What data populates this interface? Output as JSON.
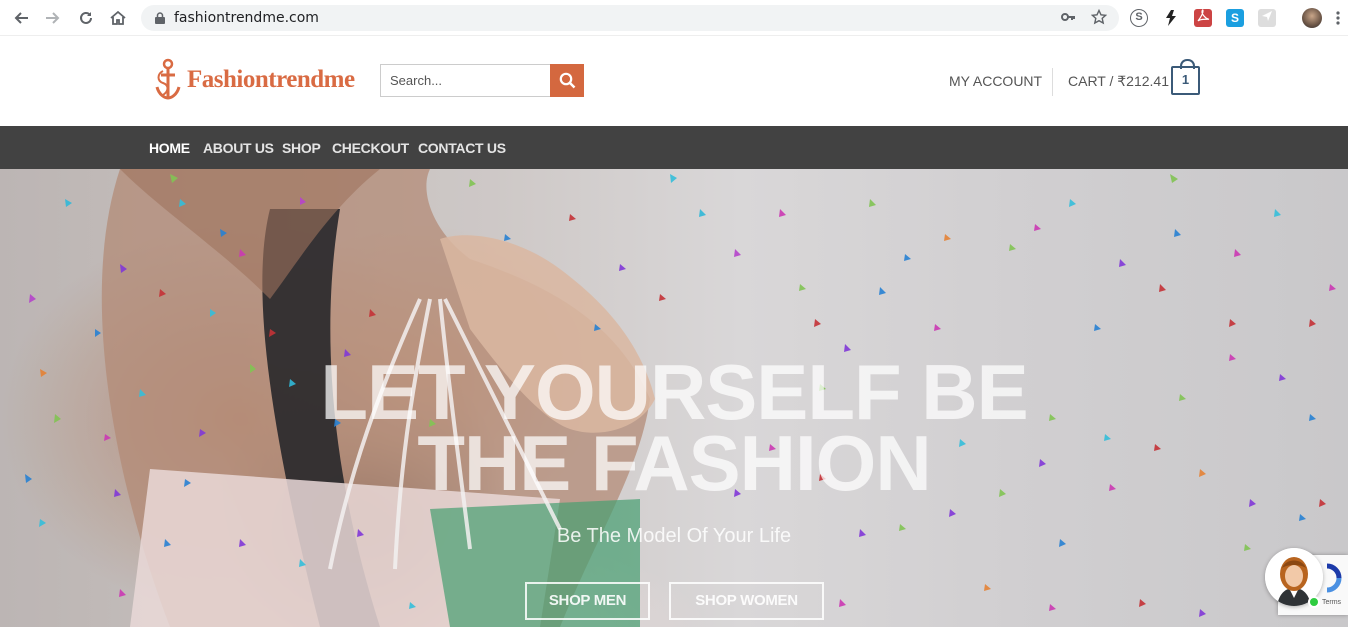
{
  "browser": {
    "url": "fashiontrendme.com"
  },
  "header": {
    "logo_text": "Fashiontrendme",
    "search_placeholder": "Search...",
    "my_account": "MY ACCOUNT",
    "cart_label": "CART / ₹212.41",
    "cart_count": "1"
  },
  "nav": {
    "items": [
      {
        "label": "HOME",
        "active": true
      },
      {
        "label": "ABOUT US"
      },
      {
        "label": "SHOP"
      },
      {
        "label": "CHECKOUT"
      },
      {
        "label": "CONTACT US"
      }
    ]
  },
  "hero": {
    "title_line1": "LET YOURSELF BE",
    "title_line2": "THE FASHION",
    "subtitle": "Be The Model Of Your Life",
    "button_men": "SHOP MEN",
    "button_women": "SHOP WOMEN"
  },
  "widgets": {
    "recaptcha_terms": "Terms"
  },
  "colors": {
    "brand": "#d96b43",
    "nav_bg": "#424242",
    "search_btn": "#d4683f",
    "cart_icon": "#3b5a78"
  },
  "icons": [
    "back-arrow-icon",
    "forward-arrow-icon",
    "reload-icon",
    "home-icon",
    "lock-icon",
    "key-icon",
    "star-icon",
    "search-icon",
    "cart-bag-icon",
    "menu-dots-icon"
  ]
}
